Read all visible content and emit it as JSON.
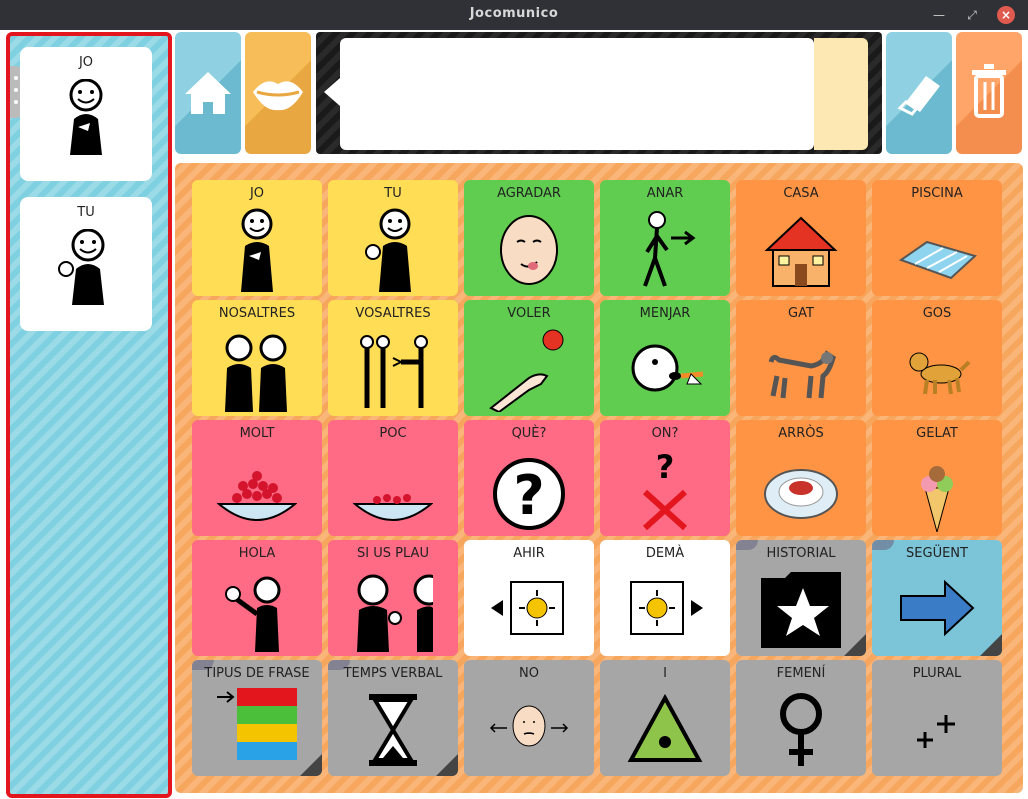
{
  "window": {
    "title": "Jocomunico"
  },
  "sidebar": {
    "items": [
      {
        "label": "JO",
        "icon": "person-pointing-self-icon"
      },
      {
        "label": "TU",
        "icon": "person-pointing-you-icon"
      }
    ]
  },
  "toolbar": {
    "home_icon": "home-icon",
    "speak_icon": "lips-icon",
    "erase_icon": "eraser-icon",
    "delete_icon": "trash-icon",
    "sentence_text": ""
  },
  "board": {
    "rows": [
      [
        {
          "label": "JO",
          "color": "yellow",
          "icon": "me-icon"
        },
        {
          "label": "TU",
          "color": "yellow",
          "icon": "you-icon"
        },
        {
          "label": "AGRADAR",
          "color": "green",
          "icon": "licking-face-icon"
        },
        {
          "label": "ANAR",
          "color": "green",
          "icon": "walking-person-icon"
        },
        {
          "label": "CASA",
          "color": "orange",
          "icon": "house-icon"
        },
        {
          "label": "PISCINA",
          "color": "orange",
          "icon": "pool-icon"
        }
      ],
      [
        {
          "label": "NOSALTRES",
          "color": "yellow",
          "icon": "we-icon"
        },
        {
          "label": "VOSALTRES",
          "color": "yellow",
          "icon": "you-plural-icon"
        },
        {
          "label": "VOLER",
          "color": "green",
          "icon": "reaching-hand-icon"
        },
        {
          "label": "MENJAR",
          "color": "green",
          "icon": "eating-icon"
        },
        {
          "label": "GAT",
          "color": "orange",
          "icon": "cat-icon"
        },
        {
          "label": "GOS",
          "color": "orange",
          "icon": "dog-icon"
        }
      ],
      [
        {
          "label": "MOLT",
          "color": "pink",
          "icon": "bowl-full-icon"
        },
        {
          "label": "POC",
          "color": "pink",
          "icon": "bowl-few-icon"
        },
        {
          "label": "QUÈ?",
          "color": "pink",
          "icon": "question-icon"
        },
        {
          "label": "ON?",
          "color": "pink",
          "icon": "where-icon"
        },
        {
          "label": "ARRÒS",
          "color": "orange",
          "icon": "rice-plate-icon"
        },
        {
          "label": "GELAT",
          "color": "orange",
          "icon": "ice-cream-icon"
        }
      ],
      [
        {
          "label": "HOLA",
          "color": "pink",
          "icon": "waving-person-icon"
        },
        {
          "label": "SI US PLAU",
          "color": "pink",
          "icon": "please-icon"
        },
        {
          "label": "AHIR",
          "color": "white",
          "icon": "yesterday-icon"
        },
        {
          "label": "DEMÀ",
          "color": "white",
          "icon": "tomorrow-icon"
        },
        {
          "label": "HISTORIAL",
          "color": "grey",
          "icon": "star-folder-icon",
          "folder": true
        },
        {
          "label": "SEGÜENT",
          "color": "blue",
          "icon": "arrow-right-icon",
          "folder": true
        }
      ],
      [
        {
          "label": "TIPUS DE FRASE",
          "color": "grey",
          "icon": "sentence-type-icon",
          "folder": true
        },
        {
          "label": "TEMPS VERBAL",
          "color": "grey",
          "icon": "hourglass-icon",
          "folder": true
        },
        {
          "label": "NO",
          "color": "grey",
          "icon": "head-shake-icon"
        },
        {
          "label": "I",
          "color": "grey",
          "icon": "triangle-dot-icon"
        },
        {
          "label": "FEMENÍ",
          "color": "grey",
          "icon": "female-symbol-icon"
        },
        {
          "label": "PLURAL",
          "color": "grey",
          "icon": "plural-plus-icon"
        }
      ]
    ]
  },
  "colors": {
    "yellow": "#ffdd55",
    "green": "#60cd50",
    "orange": "#ff9444",
    "pink": "#ff6a84",
    "white": "#ffffff",
    "grey": "#a6a6a6",
    "blue": "#7cc4d8",
    "selection": "#e3161e"
  }
}
